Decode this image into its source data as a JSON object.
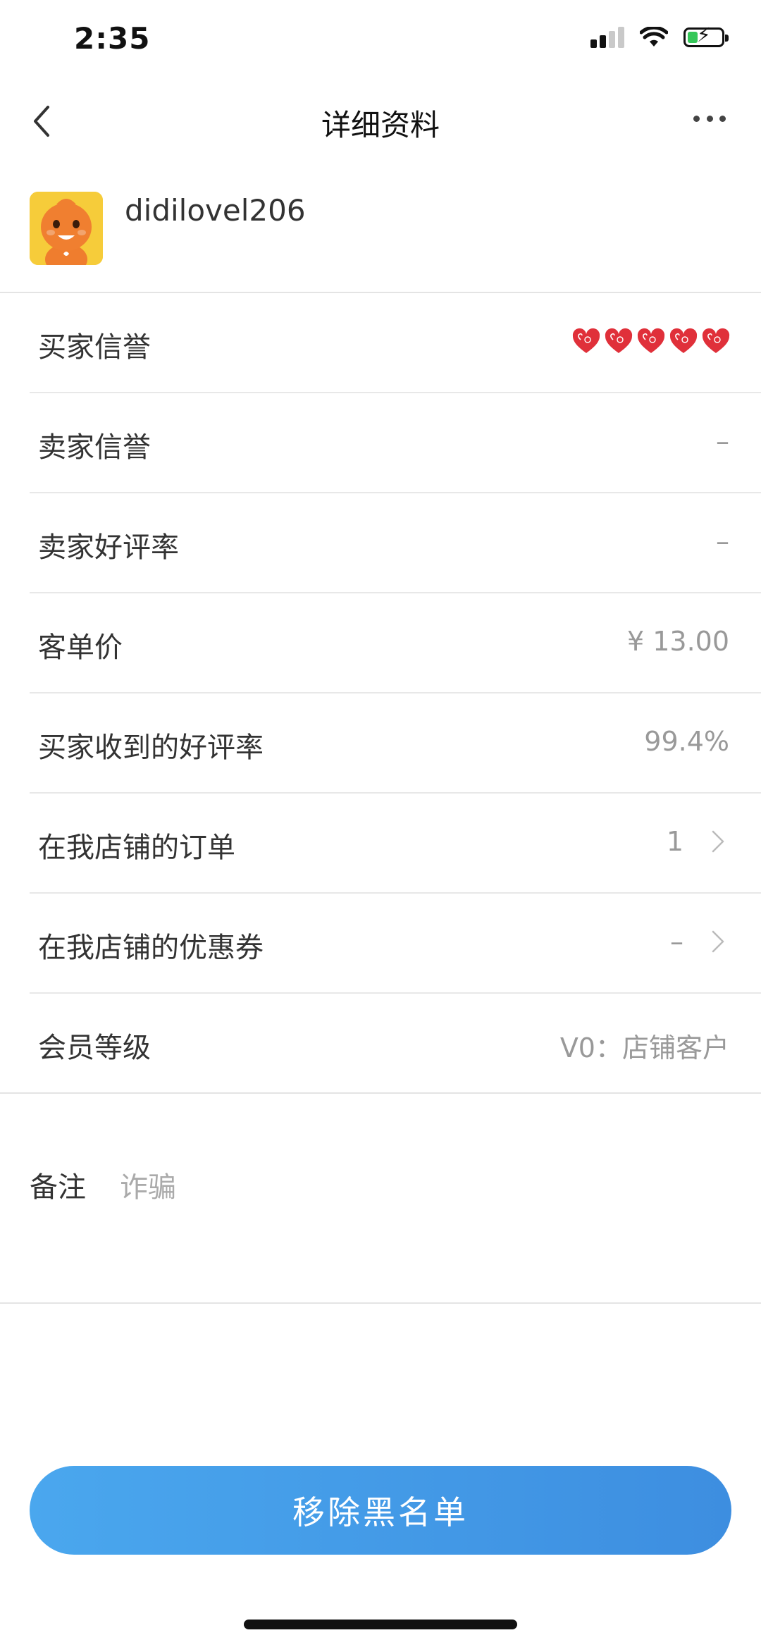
{
  "status_bar": {
    "time": "2:35"
  },
  "nav": {
    "title": "详细资料"
  },
  "profile": {
    "username": "didilovel206"
  },
  "rows": [
    {
      "label": "买家信誉",
      "value": "",
      "hearts": 5
    },
    {
      "label": "卖家信誉",
      "value": "–"
    },
    {
      "label": "卖家好评率",
      "value": "–"
    },
    {
      "label": "客单价",
      "value": "¥ 13.00"
    },
    {
      "label": "买家收到的好评率",
      "value": "99.4%"
    },
    {
      "label": "在我店铺的订单",
      "value": "1",
      "arrow": true
    },
    {
      "label": "在我店铺的优惠券",
      "value": "–",
      "arrow": true
    },
    {
      "label": "会员等级",
      "value": "V0：店铺客户"
    }
  ],
  "note": {
    "label": "备注",
    "value": "诈骗"
  },
  "button": {
    "label": "移除黑名单"
  },
  "colors": {
    "accent": "#4aa7ee",
    "heart": "#e0303a",
    "avatar_bg": "#f6cc3a"
  }
}
